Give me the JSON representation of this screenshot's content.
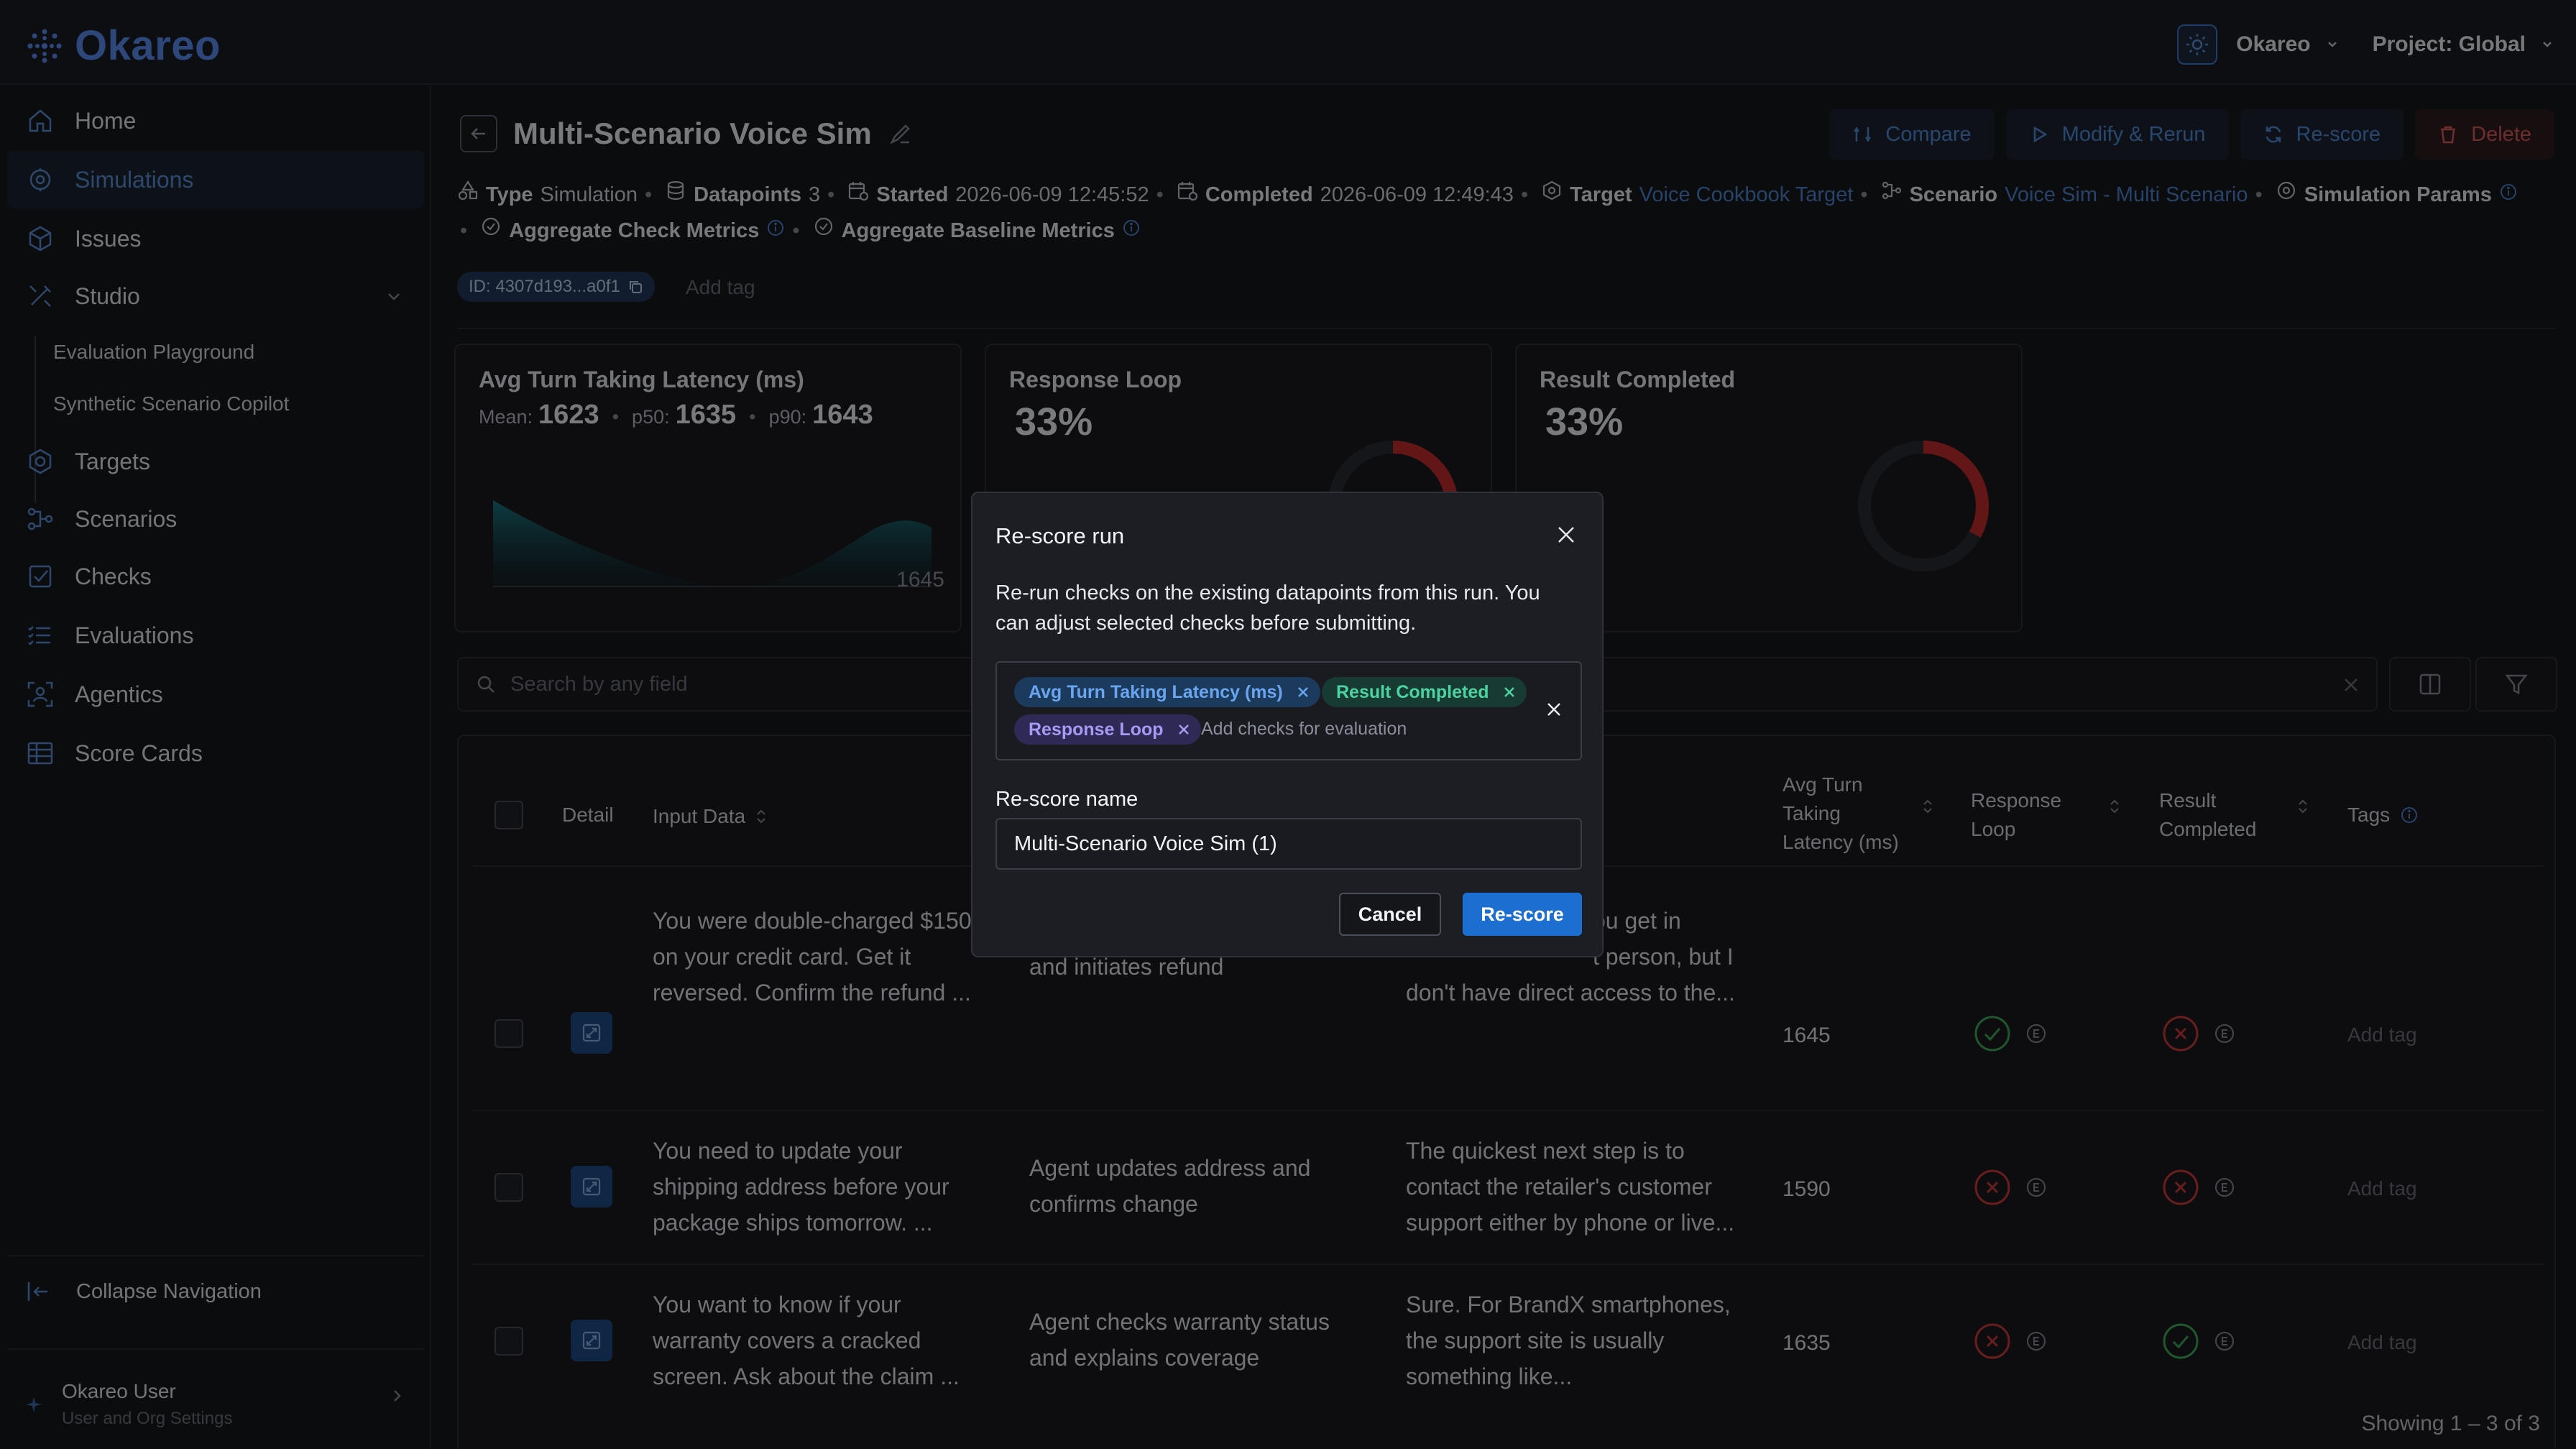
{
  "app": {
    "logo_text": "Okareo"
  },
  "topbar": {
    "org_label": "Okareo",
    "project_label": "Project: Global"
  },
  "sidebar": {
    "items": [
      {
        "label": "Home",
        "icon": "home-icon"
      },
      {
        "label": "Simulations",
        "icon": "simulations-icon",
        "active": true
      },
      {
        "label": "Issues",
        "icon": "cube-icon"
      },
      {
        "label": "Studio",
        "icon": "studio-icon"
      },
      {
        "label": "Targets",
        "icon": "hexagon-icon"
      },
      {
        "label": "Scenarios",
        "icon": "scenario-icon"
      },
      {
        "label": "Checks",
        "icon": "check-square-icon"
      },
      {
        "label": "Evaluations",
        "icon": "list-icon"
      },
      {
        "label": "Agentics",
        "icon": "agentics-icon"
      },
      {
        "label": "Score Cards",
        "icon": "table-icon"
      }
    ],
    "studio_sub": [
      "Evaluation Playground",
      "Synthetic Scenario Copilot"
    ],
    "collapse_label": "Collapse Navigation",
    "user": {
      "name": "Okareo User",
      "sub": "User and Org Settings"
    }
  },
  "page": {
    "title": "Multi-Scenario Voice Sim",
    "actions": {
      "compare": "Compare",
      "modify": "Modify & Rerun",
      "rescore": "Re-score",
      "delete": "Delete"
    },
    "meta": {
      "type_label": "Type",
      "type_value": "Simulation",
      "datapoints_label": "Datapoints",
      "datapoints_value": "3",
      "started_label": "Started",
      "started_value": "2026-06-09 12:45:52",
      "completed_label": "Completed",
      "completed_value": "2026-06-09 12:49:43",
      "target_label": "Target",
      "target_value": "Voice Cookbook Target",
      "scenario_label": "Scenario",
      "scenario_value": "Voice Sim - Multi Scenario",
      "params_label": "Simulation Params",
      "agg_check_label": "Aggregate Check Metrics",
      "agg_baseline_label": "Aggregate Baseline Metrics"
    },
    "id_pill": "ID: 4307d193...a0f1",
    "add_tag": "Add tag"
  },
  "cards": {
    "latency": {
      "title": "Avg Turn Taking Latency (ms)",
      "mean_label": "Mean:",
      "mean": "1623",
      "p50_label": "p50:",
      "p50": "1635",
      "p90_label": "p90:",
      "p90": "1643",
      "max_label": "1645"
    },
    "loop": {
      "title": "Response Loop",
      "value": "33%",
      "fraction": 0.33
    },
    "completed": {
      "title": "Result Completed",
      "value": "33%",
      "fraction": 0.33
    }
  },
  "search": {
    "placeholder": "Search by any field"
  },
  "table": {
    "headers": {
      "detail": "Detail",
      "input": "Input Data",
      "latency_1": "Avg Turn",
      "latency_2": "Taking",
      "latency_3": "Latency (ms)",
      "loop_1": "Response",
      "loop_2": "Loop",
      "completed_1": "Result",
      "completed_2": "Completed",
      "tags": "Tags"
    },
    "rows": [
      {
        "input_1": "You were double-charged $150",
        "input_2": "on your credit card. Get it",
        "input_3": "reversed. Confirm the refund ...",
        "expected_1": "and initiates refund",
        "expected_2": "",
        "output_1": "ou get in",
        "output_2": "t person, but I",
        "output_3": "don't have direct access to the...",
        "latency": "1645",
        "loop_pass": true,
        "completed_pass": false,
        "tag": "Add tag"
      },
      {
        "input_1": "You need to update your",
        "input_2": "shipping address before your",
        "input_3": "package ships tomorrow. ...",
        "expected_1": "Agent updates address and",
        "expected_2": "confirms change",
        "output_1": "The quickest next step is to",
        "output_2": "contact the retailer's customer",
        "output_3": "support either by phone or live...",
        "latency": "1590",
        "loop_pass": false,
        "completed_pass": false,
        "tag": "Add tag"
      },
      {
        "input_1": "You want to know if your",
        "input_2": "warranty covers a cracked",
        "input_3": "screen. Ask about the claim ...",
        "expected_1": "Agent checks warranty status",
        "expected_2": "and explains coverage",
        "output_1": "Sure. For BrandX smartphones,",
        "output_2": "the support site is usually",
        "output_3": "something like...",
        "latency": "1635",
        "loop_pass": false,
        "completed_pass": true,
        "tag": "Add tag"
      }
    ],
    "showing": "Showing 1 – 3 of 3"
  },
  "modal": {
    "title": "Re-score run",
    "desc_1": "Re-run checks on the existing datapoints from this run. You",
    "desc_2": "can adjust selected checks before submitting.",
    "chips": [
      "Avg Turn Taking Latency (ms)",
      "Result Completed",
      "Response Loop"
    ],
    "chips_placeholder": "Add checks for evaluation",
    "name_label": "Re-score name",
    "name_value": "Multi-Scenario Voice Sim (1)",
    "cancel": "Cancel",
    "submit": "Re-score"
  },
  "colors": {
    "accent": "#1c6fd0",
    "pass": "#3fae5a",
    "fail": "#d33c3c",
    "brand": "#5b8ef5"
  }
}
